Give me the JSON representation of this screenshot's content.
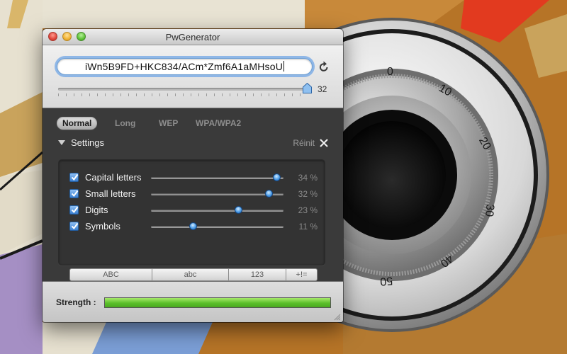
{
  "window": {
    "title": "PwGenerator",
    "controls": [
      "close",
      "minimize",
      "zoom"
    ]
  },
  "password": {
    "value": "iWn5B9FD+HKC834/ACm*Zmf6A1aMHsoU",
    "length": 32,
    "length_max": 32,
    "refresh_icon": "refresh-icon"
  },
  "tabs": [
    {
      "label": "Normal",
      "active": true
    },
    {
      "label": "Long",
      "active": false
    },
    {
      "label": "WEP",
      "active": false
    },
    {
      "label": "WPA/WPA2",
      "active": false
    }
  ],
  "settings": {
    "label": "Settings",
    "reset_label": "Réinit",
    "options": [
      {
        "label": "Capital letters",
        "checked": true,
        "percent_label": "34 %",
        "slider_fraction": 0.95
      },
      {
        "label": "Small letters",
        "checked": true,
        "percent_label": "32 %",
        "slider_fraction": 0.89
      },
      {
        "label": "Digits",
        "checked": true,
        "percent_label": "23 %",
        "slider_fraction": 0.66
      },
      {
        "label": "Symbols",
        "checked": true,
        "percent_label": "11 %",
        "slider_fraction": 0.32
      }
    ],
    "charset_buttons": [
      "ABC",
      "abc",
      "123",
      "+!="
    ]
  },
  "strength": {
    "label": "Strength :",
    "fraction": 1.0
  },
  "colors": {
    "accent_blue": "#3a7fd0",
    "strength_green": "#5bbf2a"
  },
  "background": {
    "dial_numbers": [
      "0",
      "10",
      "20",
      "30",
      "40",
      "50"
    ]
  }
}
